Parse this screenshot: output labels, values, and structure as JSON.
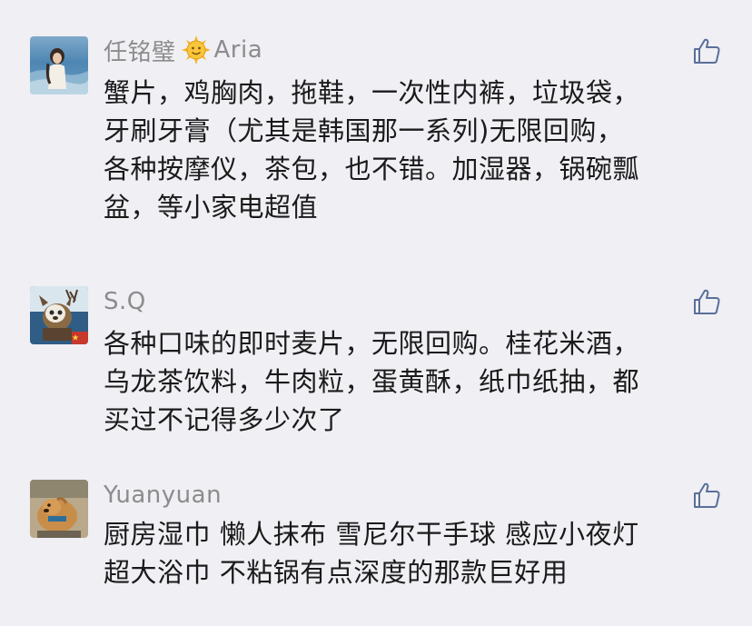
{
  "comments": [
    {
      "name": "任铭璧",
      "name_suffix": "Aria",
      "name_emoji": "sun-face-icon",
      "lines": [
        "蟹片，鸡胸肉，拖鞋，一次性内裤，垃圾袋，",
        "牙刷牙膏（尤其是韩国那一系列)无限回购，",
        "各种按摩仪，茶包，也不错。加湿器，锅碗瓢",
        "盆，等小家电超值"
      ]
    },
    {
      "name": "S.Q",
      "lines": [
        "各种口味的即时麦片，无限回购。桂花米酒，",
        "乌龙茶饮料，牛肉粒，蛋黄酥，纸巾纸抽，都",
        "买过不记得多少次了"
      ]
    },
    {
      "name": "Yuanyuan",
      "lines": [
        "厨房湿巾 懒人抹布 雪尼尔干手球 感应小夜灯",
        "超大浴巾 不粘锅有点深度的那款巨好用"
      ]
    }
  ],
  "colors": {
    "background": "#efeff4",
    "name": "#8c8c8c",
    "text": "#1a1a1a",
    "like_icon": "#5a6f9a"
  },
  "icons": {
    "like": "thumbs-up-icon"
  }
}
